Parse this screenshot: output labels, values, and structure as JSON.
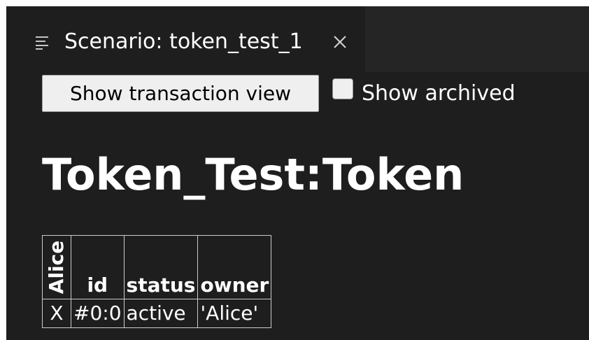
{
  "tab": {
    "icon": "list-icon",
    "title": "Scenario: token_test_1",
    "close_icon": "close-icon"
  },
  "toolbar": {
    "transaction_view_label": "Show transaction view",
    "show_archived_label": "Show archived",
    "show_archived_checked": false
  },
  "page_title": "Token_Test:Token",
  "table": {
    "party_header": "Alice",
    "columns": [
      "id",
      "status",
      "owner"
    ],
    "rows": [
      {
        "party_mark": "X",
        "id": "#0:0",
        "status": "active",
        "owner": "'Alice'"
      }
    ]
  }
}
